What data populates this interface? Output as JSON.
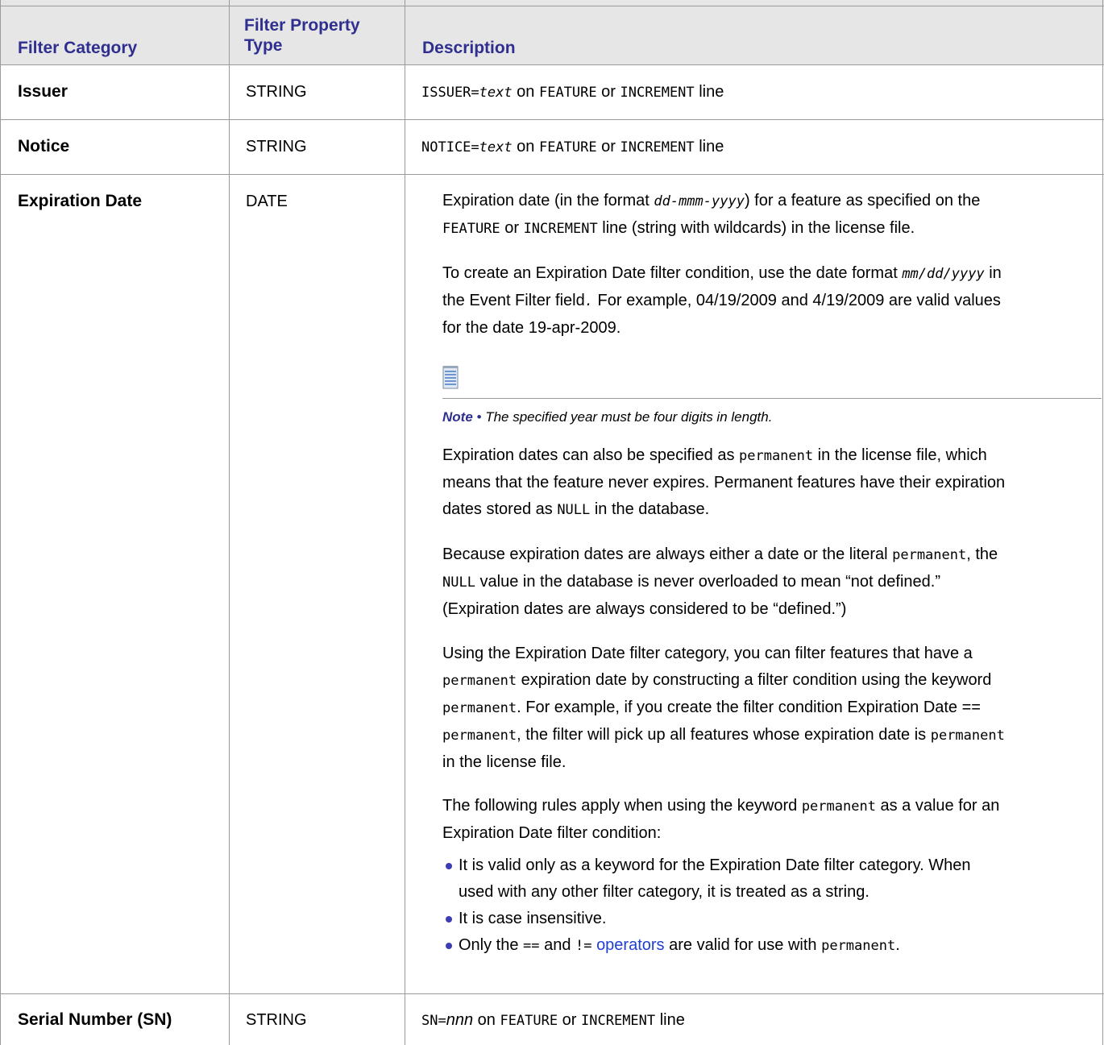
{
  "headers": {
    "category": "Filter Category",
    "type_line1": "Filter Property",
    "type_line2": "Type",
    "description": "Description"
  },
  "rows": [
    {
      "category": "Issuer",
      "type": "STRING",
      "desc": {
        "code1": "ISSUER=",
        "code2": "text",
        "t1": " on ",
        "code3": "FEATURE",
        "t2": " or ",
        "code4": "INCREMENT",
        "t3": " line"
      }
    },
    {
      "category": "Notice",
      "type": "STRING",
      "desc": {
        "code1": "NOTICE=",
        "code2": "text",
        "t1": " on ",
        "code3": "FEATURE",
        "t2": " or ",
        "code4": "INCREMENT",
        "t3": " line"
      }
    },
    {
      "category": "Expiration Date",
      "type": "DATE"
    },
    {
      "category": "Serial Number (SN)",
      "type": "STRING",
      "desc": {
        "code1": "SN=",
        "code2": "nnn",
        "t1": " on ",
        "code3": "FEATURE",
        "t2": " or ",
        "code4": "INCREMENT",
        "t3": " line"
      }
    }
  ],
  "expiration": {
    "p1_a": "Expiration date (in the format ",
    "p1_fmt": "dd-mmm-yyyy",
    "p1_b": ") for a feature as specified on the",
    "p1_feature": "FEATURE",
    "p1_or": " or ",
    "p1_increment": "INCREMENT",
    "p1_c": " line (string with wildcards) in the license file.",
    "p2_a": "To create an Expiration Date filter condition, use the date format ",
    "p2_fmt": "mm/dd/yyyy",
    "p2_b": " in",
    "p2_c": "the Event Filter field",
    "p2_dot": ".",
    "p2_d": " For example, 04/19/2009 and 4/19/2009 are valid values",
    "p2_e": "for the date 19-apr-2009.",
    "note_label": "Note",
    "note_dot": " • ",
    "note_text": "The specified year must be four digits in length.",
    "p3_a": "Expiration dates can also be specified as ",
    "p3_perm": "permanent",
    "p3_b": " in the license file, which",
    "p3_c": "means that the feature never expires. Permanent features have their expiration",
    "p3_d": "dates stored as ",
    "p3_null": "NULL",
    "p3_e": " in the database.",
    "p4_a": "Because expiration dates are always either a date or the literal ",
    "p4_perm": "permanent",
    "p4_b": ", the",
    "p4_null": "NULL",
    "p4_c": " value in the database is never overloaded to mean “not defined.”",
    "p4_d": "(Expiration dates are always considered to be “defined.”)",
    "p5_a": "Using the Expiration Date filter category, you can filter features that have a",
    "p5_perm1": "permanent",
    "p5_b": " expiration date by constructing a filter condition using the keyword",
    "p5_perm2": "permanent",
    "p5_c": ". For example, if you create the filter condition Expiration Date ==",
    "p5_perm3": "permanent",
    "p5_d": ", the filter will pick up all features whose expiration date is ",
    "p5_perm4": "permanent",
    "p5_e": "in the license file.",
    "p6_a": "The following rules apply when using the keyword ",
    "p6_perm": "permanent",
    "p6_b": " as a value for an",
    "p6_c": "Expiration Date filter condition:",
    "b1_a": "It is valid only as a keyword for the Expiration Date filter category. When",
    "b1_b": "used with any other filter category, it is treated as a string.",
    "b2": "It is case insensitive.",
    "b3_a": "Only the ",
    "b3_eq": "==",
    "b3_and": " and ",
    "b3_ne": "!=",
    "b3_sp": " ",
    "b3_link": "operators",
    "b3_b": " are valid for use with ",
    "b3_perm": "permanent",
    "b3_c": "."
  },
  "colors": {
    "header_text": "#2f2f8f",
    "header_bg": "#e6e6e6",
    "link": "#1f3fd0",
    "bullet": "#3c3cb4"
  }
}
